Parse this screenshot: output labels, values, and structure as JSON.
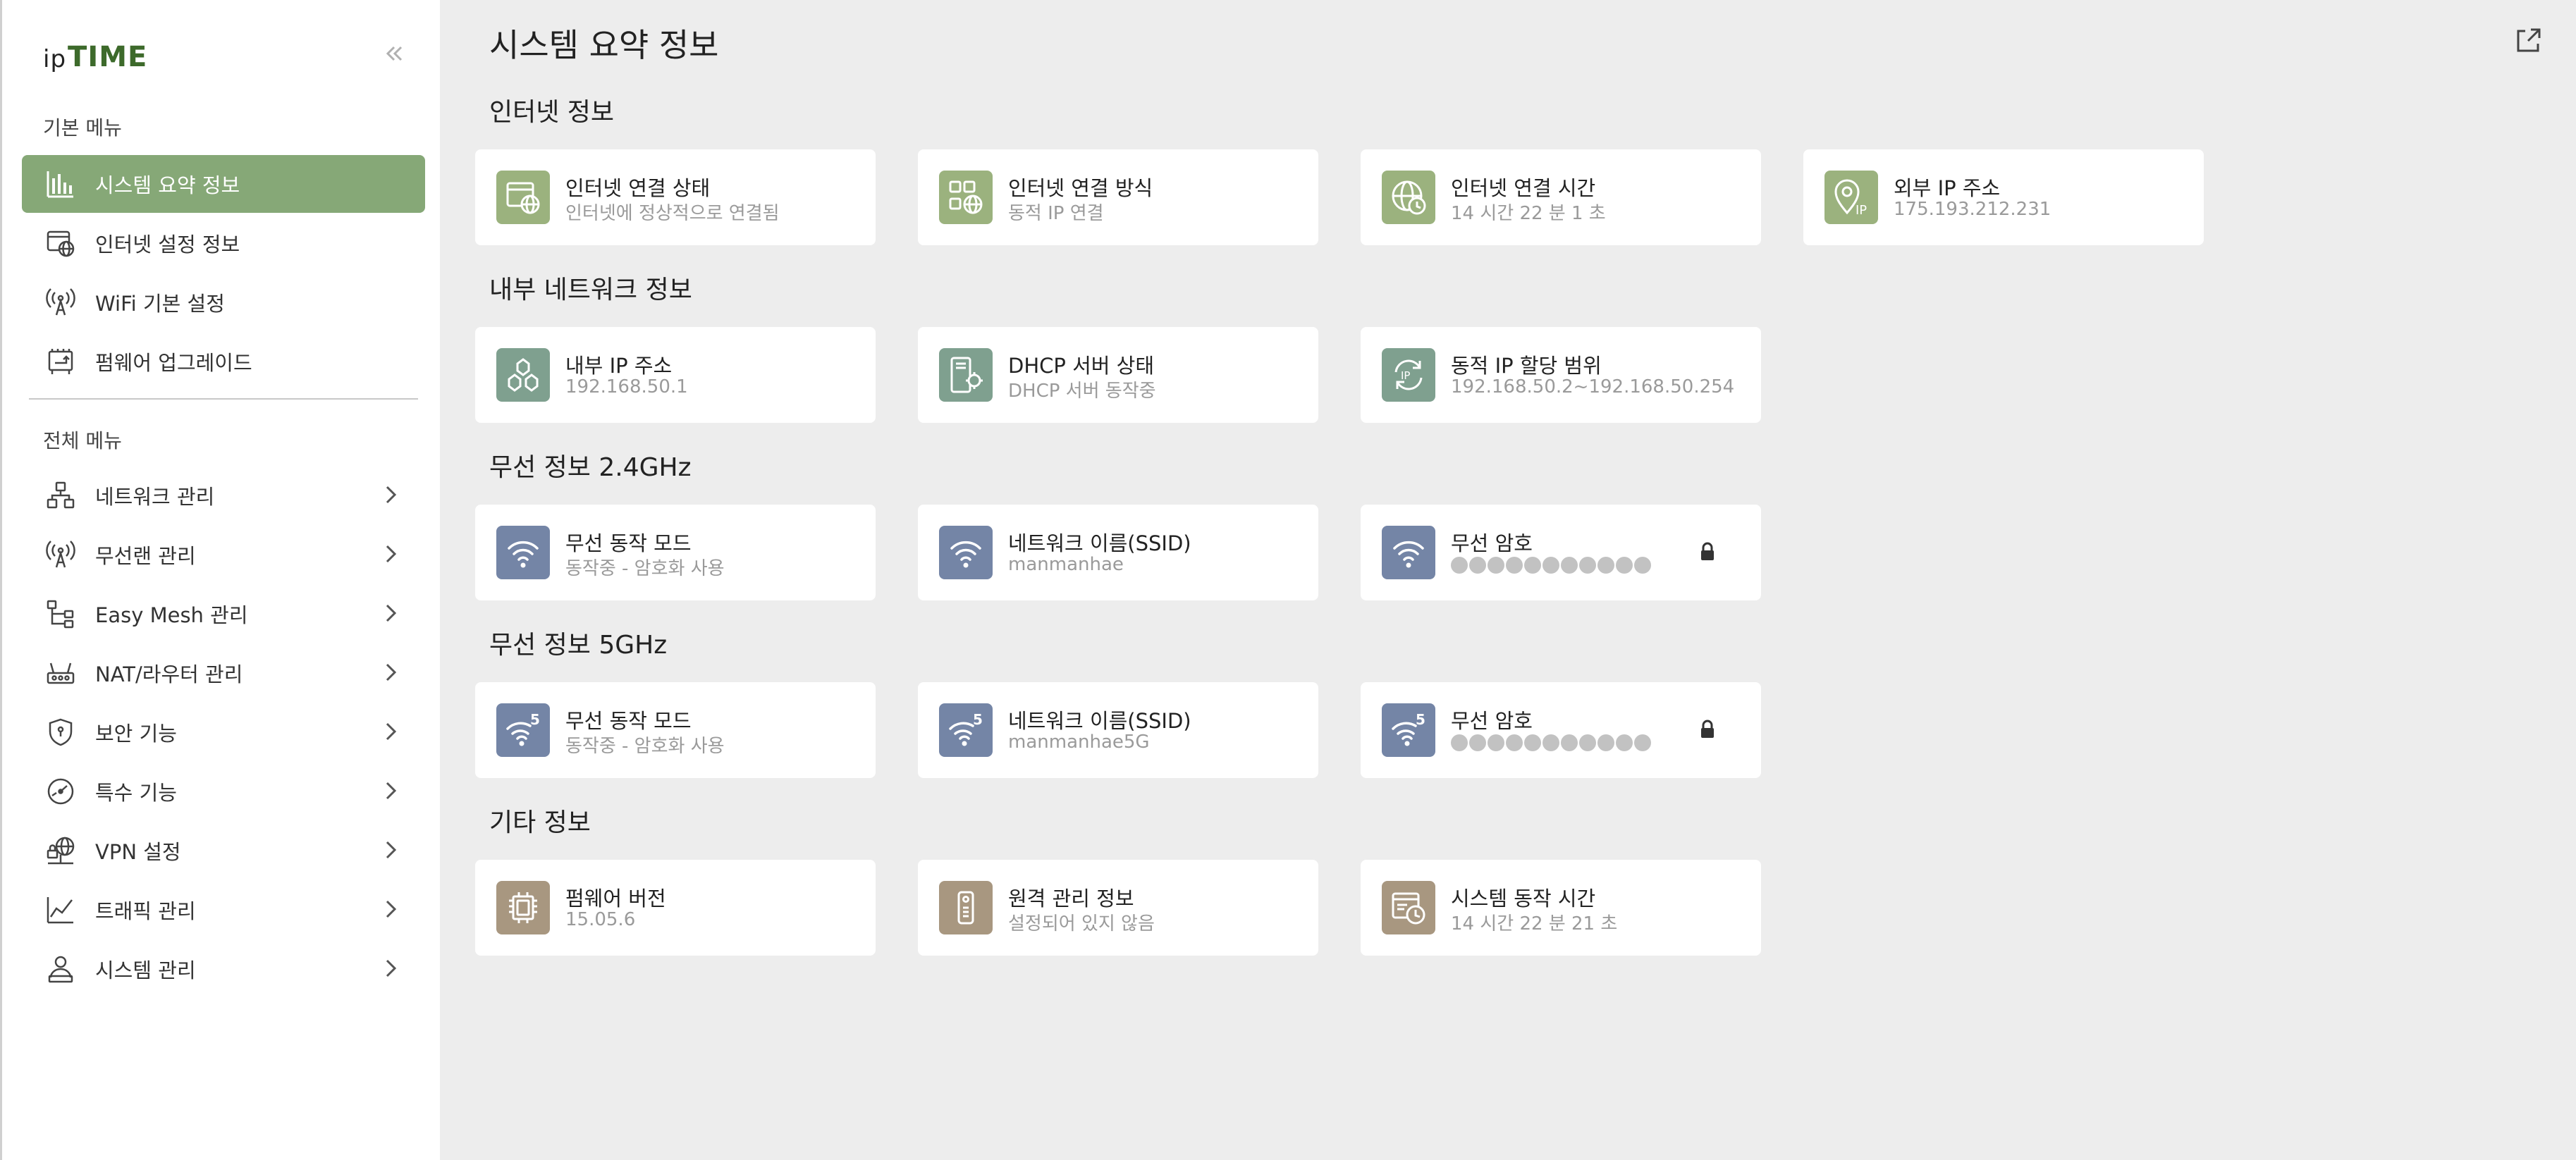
{
  "logo": {
    "ip": "ip",
    "time": "TIME"
  },
  "sidebar": {
    "collapse_icon": "double-chevron-left-icon",
    "basic_label": "기본 메뉴",
    "basic_items": [
      {
        "label": "시스템 요약 정보",
        "icon": "bar-chart-icon",
        "active": true
      },
      {
        "label": "인터넷 설정 정보",
        "icon": "globe-window-icon"
      },
      {
        "label": "WiFi 기본 설정",
        "icon": "antenna-icon"
      },
      {
        "label": "펌웨어 업그레이드",
        "icon": "firmware-icon"
      }
    ],
    "all_label": "전체 메뉴",
    "all_items": [
      {
        "label": "네트워크 관리",
        "icon": "network-icon"
      },
      {
        "label": "무선랜 관리",
        "icon": "antenna-icon"
      },
      {
        "label": "Easy Mesh 관리",
        "icon": "mesh-tree-icon"
      },
      {
        "label": "NAT/라우터 관리",
        "icon": "router-icon"
      },
      {
        "label": "보안 기능",
        "icon": "shield-icon"
      },
      {
        "label": "특수 기능",
        "icon": "gauge-icon"
      },
      {
        "label": "VPN 설정",
        "icon": "vpn-icon"
      },
      {
        "label": "트래픽 관리",
        "icon": "traffic-chart-icon"
      },
      {
        "label": "시스템 관리",
        "icon": "system-user-icon"
      }
    ]
  },
  "main": {
    "title": "시스템 요약 정보",
    "export_icon": "export-icon",
    "groups": [
      {
        "title": "인터넷 정보",
        "cards": [
          {
            "title": "인터넷 연결 상태",
            "sub": "인터넷에 정상적으로 연결됨",
            "icon": "globe-window-icon",
            "color": "#9bb27e"
          },
          {
            "title": "인터넷 연결 방식",
            "sub": "동적 IP 연결",
            "icon": "connection-method-icon",
            "color": "#9bb27e"
          },
          {
            "title": "인터넷 연결 시간",
            "sub": "14 시간 22 분 1 초",
            "icon": "globe-clock-icon",
            "color": "#9bb27e"
          },
          {
            "title": "외부 IP 주소",
            "sub": "175.193.212.231",
            "icon": "location-ip-icon",
            "color": "#9bb27e"
          }
        ]
      },
      {
        "title": "내부 네트워크 정보",
        "cards": [
          {
            "title": "내부 IP 주소",
            "sub": "192.168.50.1",
            "icon": "network-icon",
            "color": "#7fa08f"
          },
          {
            "title": "DHCP 서버 상태",
            "sub": "DHCP 서버 동작중",
            "icon": "dhcp-server-icon",
            "color": "#7fa08f"
          },
          {
            "title": "동적 IP 할당 범위",
            "sub": "192.168.50.2~192.168.50.254",
            "icon": "ip-refresh-icon",
            "color": "#7fa08f"
          }
        ]
      },
      {
        "title": "무선 정보 2.4GHz",
        "cards": [
          {
            "title": "무선 동작 모드",
            "sub": "동작중 - 암호화 사용",
            "icon": "wifi-icon",
            "color": "#7485a6"
          },
          {
            "title": "네트워크 이름(SSID)",
            "sub": "manmanhae",
            "icon": "wifi-icon",
            "color": "#7485a6"
          },
          {
            "title": "무선 암호",
            "sub": "",
            "icon": "wifi-icon",
            "color": "#7485a6",
            "masked": true
          }
        ]
      },
      {
        "title": "무선 정보 5GHz",
        "cards": [
          {
            "title": "무선 동작 모드",
            "sub": "동작중 - 암호화 사용",
            "icon": "wifi-5g-icon",
            "color": "#7485a6"
          },
          {
            "title": "네트워크 이름(SSID)",
            "sub": "manmanhae5G",
            "icon": "wifi-5g-icon",
            "color": "#7485a6"
          },
          {
            "title": "무선 암호",
            "sub": "",
            "icon": "wifi-5g-icon",
            "color": "#7485a6",
            "masked": true
          }
        ]
      },
      {
        "title": "기타 정보",
        "cards": [
          {
            "title": "펌웨어 버전",
            "sub": "15.05.6",
            "icon": "chip-icon",
            "color": "#a89780"
          },
          {
            "title": "원격 관리 정보",
            "sub": "설정되어 있지 않음",
            "icon": "remote-icon",
            "color": "#a89780"
          },
          {
            "title": "시스템 동작 시간",
            "sub": "14 시간 22 분 21 초",
            "icon": "system-clock-icon",
            "color": "#a89780"
          }
        ]
      }
    ]
  }
}
